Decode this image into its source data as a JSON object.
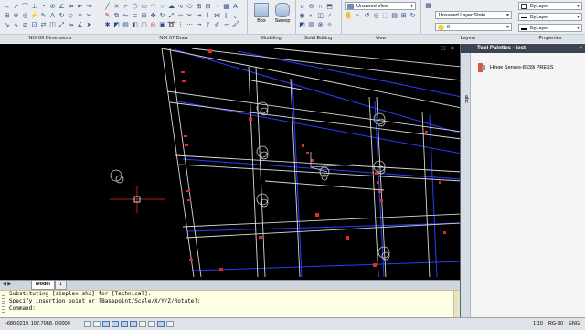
{
  "ribbon": {
    "panels": [
      {
        "title": "NIX 06 Dimensions"
      },
      {
        "title": "NIX 07 Draw"
      },
      {
        "title": "Modeling"
      },
      {
        "title": "Solid Editing"
      },
      {
        "title": "View"
      },
      {
        "title": "Layers"
      },
      {
        "title": "Properties"
      }
    ],
    "modeling_tools": [
      {
        "label": "Box"
      },
      {
        "label": "Sweep"
      }
    ],
    "view_combo": "Unsaved View",
    "layer_state_combo": "Unsaved Layer State",
    "layer_combo": "0",
    "properties": {
      "color": "ByLayer",
      "linetype": "ByLayer",
      "lineweight": "ByLayer"
    }
  },
  "viewport": {
    "window_controls": [
      "-",
      "□",
      "×"
    ]
  },
  "layout_tabs": [
    {
      "label": "Model",
      "active": true
    },
    {
      "label": "1",
      "active": false
    }
  ],
  "command_line": {
    "lines": [
      "Substituting [simplex.shx] for [Technical].",
      "Specify insertion point or [Basepoint/Scale/X/Y/Z/Rotate]:",
      "Command:"
    ]
  },
  "status_bar": {
    "coordinates": "-680.0219, 107.7068, 0.0000",
    "annotation_scale": "1:10",
    "visual_style": "RG-30",
    "model_label": "ENG"
  },
  "tool_palette": {
    "title": "Tool Palettes - test",
    "side_tab": "abc",
    "items": [
      {
        "label": "Hinge Sensys-8639i PRESS"
      }
    ]
  },
  "colors": {
    "background": "#000000",
    "cabinet_lines": "#d8d8d8",
    "blue_lines": "#2a3dff",
    "hardware_red": "#e22a2a",
    "command_bg": "#fefde6"
  }
}
